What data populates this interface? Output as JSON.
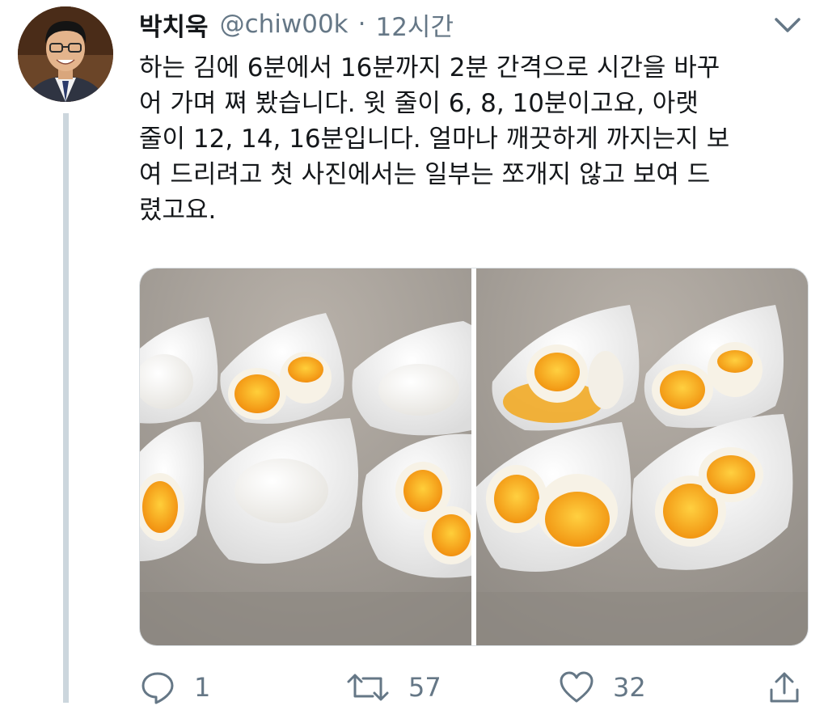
{
  "tweet": {
    "display_name": "박치욱",
    "handle": "@chiw00k",
    "separator": "·",
    "time": "12시간",
    "body": "하는 김에 6분에서 16분까지 2분 간격으로 시간을 바꾸\n어 가며 쪄 봤습니다. 윗 줄이 6, 8, 10분이고요, 아랫\n줄이 12, 14, 16분입니다. 얼마나 깨끗하게 까지는지 보\n여 드리려고 첫 사진에서는 일부는 쪼개지 않고 보여 드\n렸고요.",
    "media_icon": "egg-photo",
    "actions": {
      "reply_count": "1",
      "retweet_count": "57",
      "like_count": "32"
    }
  },
  "icons": {
    "more": "chevron-down-icon",
    "reply": "reply-icon",
    "retweet": "retweet-icon",
    "like": "heart-icon",
    "share": "share-icon"
  },
  "colors": {
    "text": "#14171a",
    "secondary": "#657786",
    "thread_line": "#ccd6dd",
    "yolk": "#f2a71b"
  }
}
